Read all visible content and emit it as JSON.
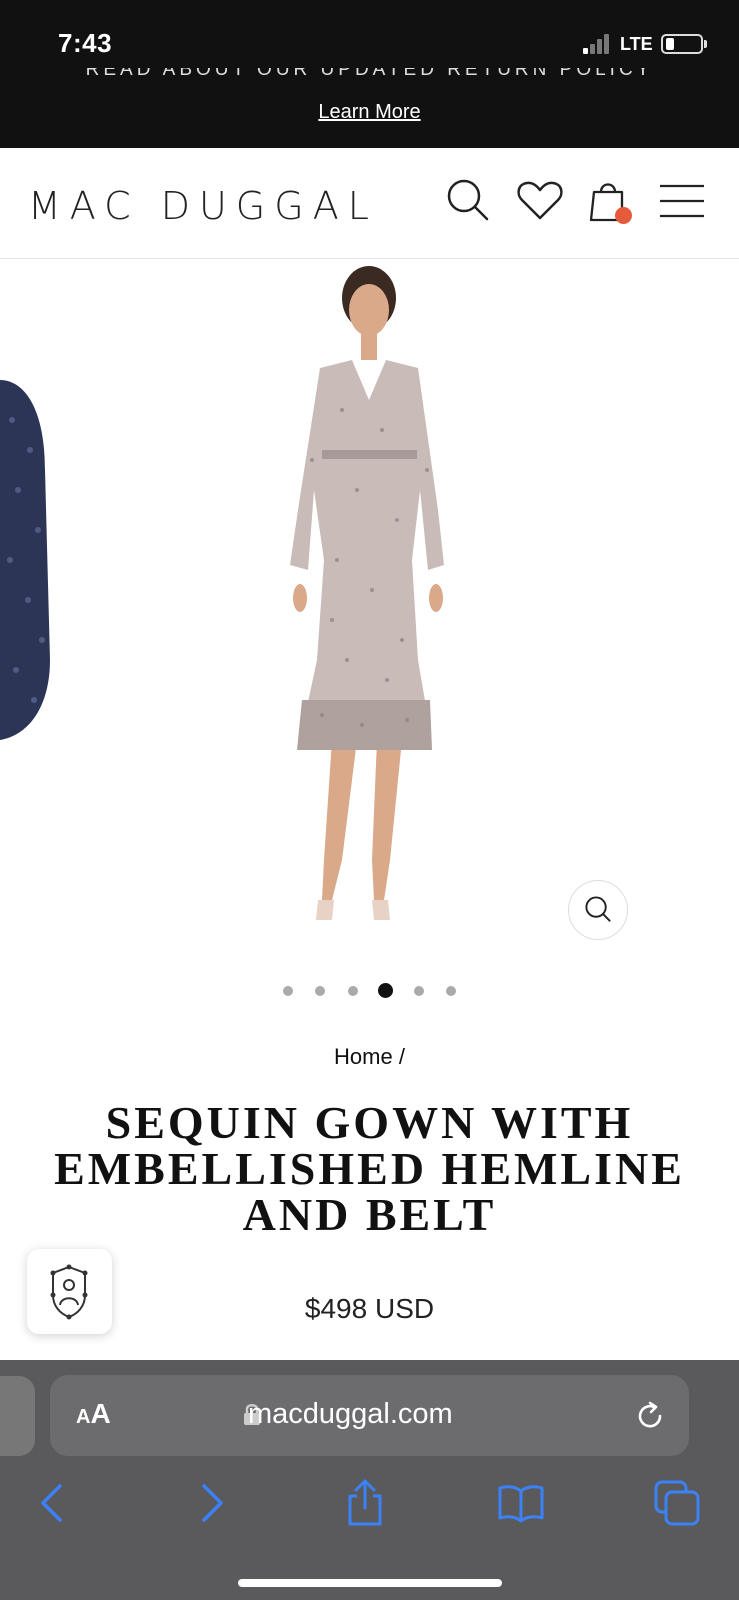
{
  "status": {
    "time": "7:43",
    "network": "LTE"
  },
  "announcement": {
    "text": "READ ABOUT OUR UPDATED RETURN POLICY",
    "link": "Learn More"
  },
  "header": {
    "logo": "MAC DUGGAL",
    "icons": [
      "search-icon",
      "heart-icon",
      "bag-icon",
      "menu-icon"
    ]
  },
  "gallery": {
    "total_images": 6,
    "active_index": 3
  },
  "breadcrumb": "Home /",
  "product": {
    "title": "SEQUIN GOWN WITH EMBELLISHED HEMLINE AND BELT",
    "price": "$498 USD"
  },
  "browser": {
    "aa_small": "A",
    "aa_large": "A",
    "url": "macduggal.com"
  },
  "colors": {
    "accent": "#e65a3c",
    "toolbar_blue": "#3b82f6"
  }
}
